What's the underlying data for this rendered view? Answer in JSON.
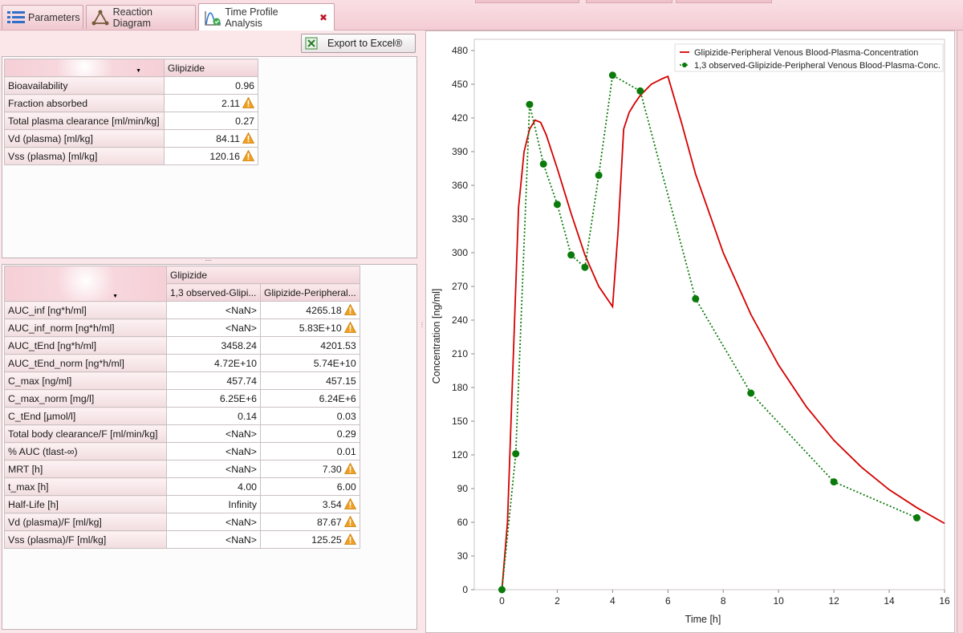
{
  "tabs": [
    {
      "label": "Parameters",
      "icon": "list-icon",
      "active": false
    },
    {
      "label": "Reaction Diagram",
      "icon": "triangle-diagram-icon",
      "active": false
    },
    {
      "label": "Time Profile Analysis",
      "icon": "time-profile-chart-icon",
      "active": true
    }
  ],
  "toolbar": {
    "export_label": "Export to Excel®"
  },
  "top_table": {
    "column": "Glipizide",
    "rows": [
      {
        "label": "Bioavailability",
        "value": "0.96",
        "warn": false
      },
      {
        "label": "Fraction absorbed",
        "value": "2.11",
        "warn": true
      },
      {
        "label": "Total plasma clearance [ml/min/kg]",
        "value": "0.27",
        "warn": false
      },
      {
        "label": "Vd (plasma) [ml/kg]",
        "value": "84.11",
        "warn": true
      },
      {
        "label": "Vss (plasma) [ml/kg]",
        "value": "120.16",
        "warn": true
      }
    ]
  },
  "bottom_table": {
    "group": "Glipizide",
    "columns": [
      "1,3 observed-Glipi...",
      "Glipizide-Peripheral..."
    ],
    "rows": [
      {
        "label": "AUC_inf [ng*h/ml]",
        "v1": "<NaN>",
        "v2": "4265.18",
        "warn": true
      },
      {
        "label": "AUC_inf_norm [ng*h/ml]",
        "v1": "<NaN>",
        "v2": "5.83E+10",
        "warn": true
      },
      {
        "label": "AUC_tEnd [ng*h/ml]",
        "v1": "3458.24",
        "v2": "4201.53",
        "warn": false
      },
      {
        "label": "AUC_tEnd_norm [ng*h/ml]",
        "v1": "4.72E+10",
        "v2": "5.74E+10",
        "warn": false
      },
      {
        "label": "C_max [ng/ml]",
        "v1": "457.74",
        "v2": "457.15",
        "warn": false
      },
      {
        "label": "C_max_norm [mg/l]",
        "v1": "6.25E+6",
        "v2": "6.24E+6",
        "warn": false
      },
      {
        "label": "C_tEnd [µmol/l]",
        "v1": "0.14",
        "v2": "0.03",
        "warn": false
      },
      {
        "label": "Total body clearance/F [ml/min/kg]",
        "v1": "<NaN>",
        "v2": "0.29",
        "warn": false
      },
      {
        "label": "% AUC (tlast-∞)",
        "v1": "<NaN>",
        "v2": "0.01",
        "warn": false
      },
      {
        "label": "MRT [h]",
        "v1": "<NaN>",
        "v2": "7.30",
        "warn": true
      },
      {
        "label": "t_max [h]",
        "v1": "4.00",
        "v2": "6.00",
        "warn": false
      },
      {
        "label": "Half-Life [h]",
        "v1": "Infinity",
        "v2": "3.54",
        "warn": true
      },
      {
        "label": "Vd (plasma)/F [ml/kg]",
        "v1": "<NaN>",
        "v2": "87.67",
        "warn": true
      },
      {
        "label": "Vss (plasma)/F [ml/kg]",
        "v1": "<NaN>",
        "v2": "125.25",
        "warn": true
      }
    ]
  },
  "colors": {
    "simulated": "#d40000",
    "observed": "#0a7a0a",
    "warning": "#f0a020"
  },
  "chart_data": {
    "type": "line",
    "xlabel": "Time [h]",
    "ylabel": "Concentration [ng/ml]",
    "xlim": [
      -1,
      16
    ],
    "ylim": [
      0,
      490
    ],
    "xticks": [
      0,
      2,
      4,
      6,
      8,
      10,
      12,
      14,
      16
    ],
    "yticks": [
      0,
      30,
      60,
      90,
      120,
      150,
      180,
      210,
      240,
      270,
      300,
      330,
      360,
      390,
      420,
      450,
      480
    ],
    "legend_position": "top-right",
    "series": [
      {
        "name": "Glipizide-Peripheral Venous Blood-Plasma-Concentration",
        "style": "solid-line",
        "x": [
          0,
          0.2,
          0.4,
          0.6,
          0.8,
          1.0,
          1.2,
          1.4,
          1.6,
          2.0,
          2.5,
          3.0,
          3.5,
          4.0,
          4.2,
          4.4,
          4.6,
          4.8,
          5.0,
          5.4,
          5.8,
          6.0,
          6.5,
          7.0,
          8.0,
          9.0,
          10.0,
          11.0,
          12.0,
          13.0,
          14.0,
          15.0,
          16.0
        ],
        "y": [
          0,
          60,
          200,
          340,
          390,
          410,
          418,
          416,
          405,
          375,
          335,
          298,
          270,
          252,
          320,
          410,
          425,
          433,
          440,
          450,
          455,
          457,
          415,
          370,
          300,
          245,
          200,
          163,
          133,
          109,
          89,
          73,
          59
        ]
      },
      {
        "name": "1,3 observed-Glipizide-Peripheral Venous Blood-Plasma-Conc.",
        "style": "dotted-line-with-markers",
        "x": [
          0,
          0.5,
          1.0,
          1.5,
          2.0,
          2.5,
          3.0,
          3.5,
          4.0,
          5.0,
          7.0,
          9.0,
          12.0,
          15.0
        ],
        "y": [
          0,
          121,
          432,
          379,
          343,
          298,
          287,
          369,
          458,
          444,
          259,
          175,
          96,
          64
        ]
      }
    ]
  }
}
